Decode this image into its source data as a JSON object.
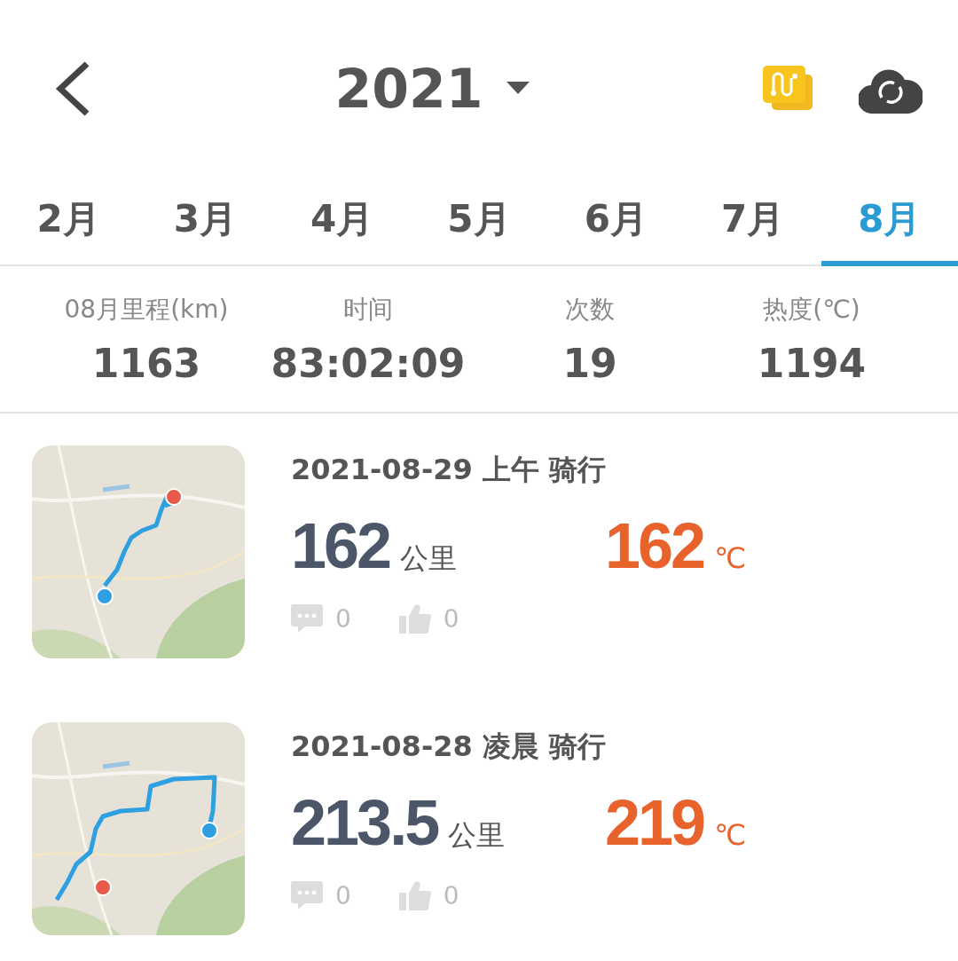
{
  "header": {
    "year": "2021"
  },
  "tabs": [
    {
      "label": "2月",
      "selected": false
    },
    {
      "label": "3月",
      "selected": false
    },
    {
      "label": "4月",
      "selected": false
    },
    {
      "label": "5月",
      "selected": false
    },
    {
      "label": "6月",
      "selected": false
    },
    {
      "label": "7月",
      "selected": false
    },
    {
      "label": "8月",
      "selected": true
    }
  ],
  "stats": [
    {
      "label": "08月里程(km)",
      "value": "1163"
    },
    {
      "label": "时间",
      "value": "83:02:09"
    },
    {
      "label": "次数",
      "value": "19"
    },
    {
      "label": "热度(℃)",
      "value": "1194"
    }
  ],
  "rides": [
    {
      "title": "2021-08-29 上午 骑行",
      "distance": "162",
      "distance_unit": "公里",
      "heat": "162",
      "heat_unit": "℃",
      "comments": "0",
      "likes": "0"
    },
    {
      "title": "2021-08-28 凌晨 骑行",
      "distance": "213.5",
      "distance_unit": "公里",
      "heat": "219",
      "heat_unit": "℃",
      "comments": "0",
      "likes": "0"
    }
  ]
}
